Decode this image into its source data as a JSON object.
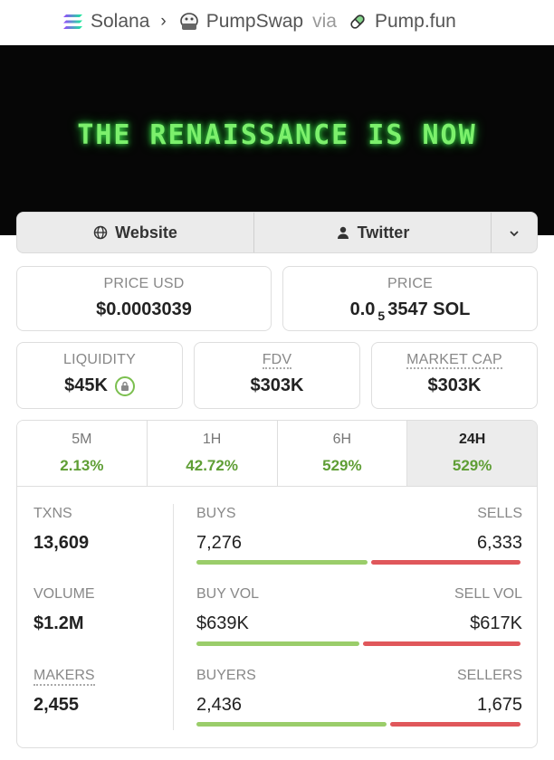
{
  "breadcrumb": {
    "chain": "Solana",
    "dex": "PumpSwap",
    "via": "via",
    "launchpad": "Pump.fun"
  },
  "banner": {
    "text": "THE RENAISSANCE IS NOW"
  },
  "links": {
    "website": "Website",
    "twitter": "Twitter"
  },
  "price_usd": {
    "label": "PRICE USD",
    "value": "$0.0003039"
  },
  "price_native": {
    "label": "PRICE",
    "prefix": "0.0",
    "subscript": "5",
    "digits": "3547 SOL"
  },
  "liquidity": {
    "label": "LIQUIDITY",
    "value": "$45K"
  },
  "fdv": {
    "label": "FDV",
    "value": "$303K"
  },
  "market_cap": {
    "label": "MARKET CAP",
    "value": "$303K"
  },
  "timeframes": [
    {
      "label": "5M",
      "change": "2.13%"
    },
    {
      "label": "1H",
      "change": "42.72%"
    },
    {
      "label": "6H",
      "change": "529%"
    },
    {
      "label": "24H",
      "change": "529%",
      "active": true
    }
  ],
  "stats": {
    "txns": {
      "label": "TXNS",
      "value": "13,609"
    },
    "buys": {
      "label": "BUYS",
      "value": "7,276"
    },
    "sells": {
      "label": "SELLS",
      "value": "6,333"
    },
    "buy_ratio": 0.535,
    "volume": {
      "label": "VOLUME",
      "value": "$1.2M"
    },
    "buy_vol": {
      "label": "BUY VOL",
      "value": "$639K"
    },
    "sell_vol": {
      "label": "SELL VOL",
      "value": "$617K"
    },
    "buy_vol_ratio": 0.509,
    "makers": {
      "label": "MAKERS",
      "value": "2,455"
    },
    "buyers": {
      "label": "BUYERS",
      "value": "2,436"
    },
    "sellers": {
      "label": "SELLERS",
      "value": "1,675"
    },
    "buyer_ratio": 0.593
  },
  "colors": {
    "positive": "#5f9e35",
    "buy_bar": "#9acd6a",
    "sell_bar": "#e0575b",
    "banner_text": "#7cf06c"
  }
}
